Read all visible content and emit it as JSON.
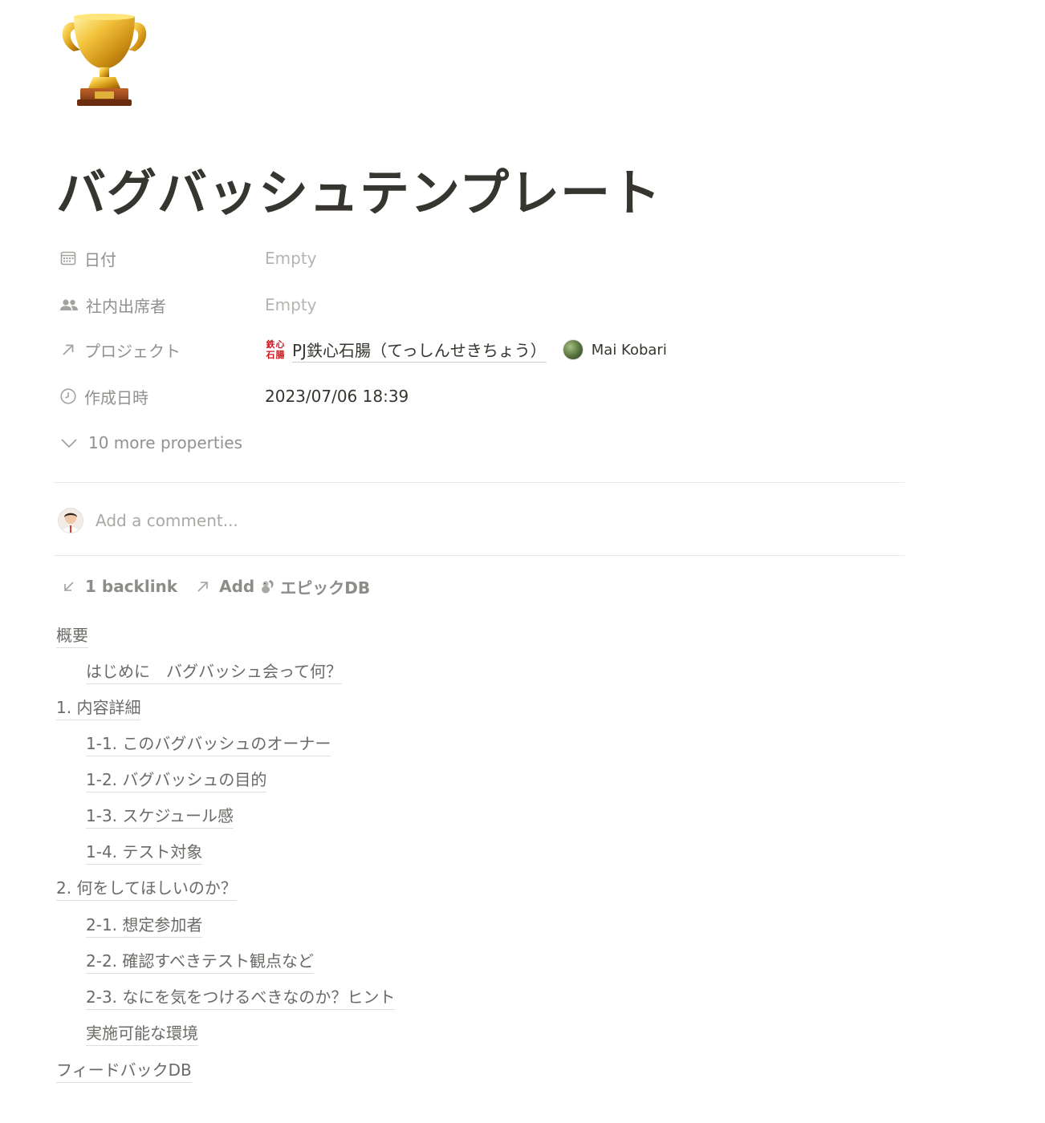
{
  "page": {
    "icon": "trophy-icon",
    "title": "バグバッシュテンプレート"
  },
  "properties": [
    {
      "name": "日付",
      "icon": "calendar-icon",
      "value": "Empty"
    },
    {
      "name": "社内出席者",
      "icon": "people-icon",
      "value": "Empty"
    },
    {
      "name": "プロジェクト",
      "icon": "relation-arrow-icon",
      "value": "PJ鉄心石腸（てっしんせきちょう）",
      "logo_text": [
        "鉄",
        "心",
        "石",
        "腸"
      ],
      "person": "Mai Kobari"
    },
    {
      "name": "作成日時",
      "icon": "clock-icon",
      "value": "2023/07/06 18:39"
    }
  ],
  "more_properties": "10 more properties",
  "comment": {
    "placeholder": "Add a comment..."
  },
  "backlinks": {
    "count_label": "1 backlink",
    "add_label": "Add",
    "db_name": "エピックDB"
  },
  "toc": [
    {
      "label": "概要",
      "level": 0
    },
    {
      "label": "はじめに　バグバッシュ会って何？",
      "level": 1
    },
    {
      "label": "1. 内容詳細",
      "level": 0
    },
    {
      "label": "1-1. このバグバッシュのオーナー",
      "level": 1
    },
    {
      "label": "1-2. バグバッシュの目的",
      "level": 1
    },
    {
      "label": "1-3. スケジュール感",
      "level": 1
    },
    {
      "label": "1-4. テスト対象",
      "level": 1
    },
    {
      "label": "2. 何をしてほしいのか？",
      "level": 0
    },
    {
      "label": "2-1. 想定参加者",
      "level": 1
    },
    {
      "label": "2-2. 確認すべきテスト観点など",
      "level": 1
    },
    {
      "label": "2-3. なにを気をつけるべきなのか？ヒント",
      "level": 1
    },
    {
      "label": "実施可能な環境",
      "level": 1
    },
    {
      "label": "フィードバックDB",
      "level": 0
    }
  ],
  "colors": {
    "text": "#37352f",
    "muted": "#91918e",
    "empty": "#b5b4b0",
    "logo_red": "#d0151f"
  }
}
